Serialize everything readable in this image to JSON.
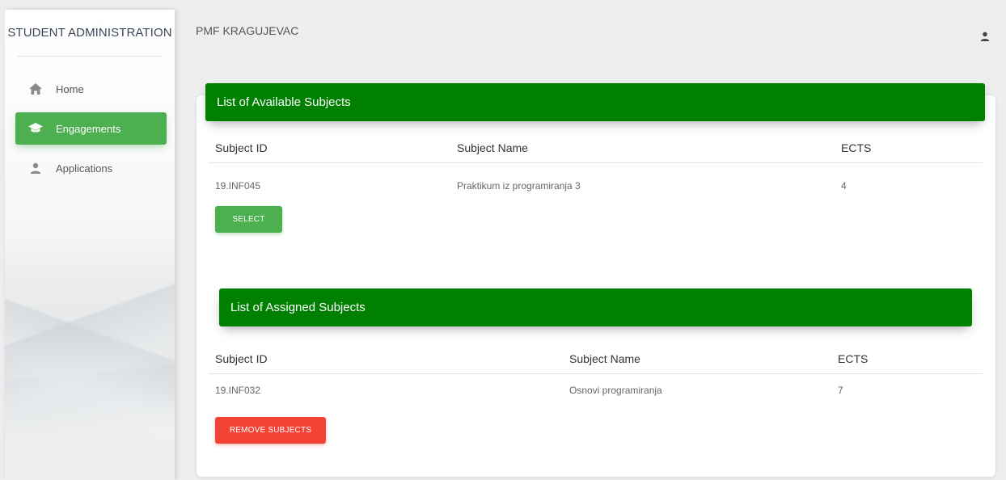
{
  "sidebar": {
    "brand": "STUDENT ADMINISTRATION",
    "items": [
      {
        "label": "Home",
        "icon": "home-icon"
      },
      {
        "label": "Engagements",
        "icon": "graduation-cap-icon",
        "active": true
      },
      {
        "label": "Applications",
        "icon": "person-icon"
      }
    ]
  },
  "header": {
    "title": "PMF KRAGUJEVAC",
    "user_icon": "person-icon"
  },
  "available": {
    "title": "List of Available Subjects",
    "columns": [
      "Subject ID",
      "Subject Name",
      "ECTS"
    ],
    "rows": [
      {
        "id": "19.INF045",
        "name": "Praktikum iz programiranja 3",
        "ects": "4"
      }
    ],
    "button": "SELECT"
  },
  "assigned": {
    "title": "List of Assigned Subjects",
    "columns": [
      "Subject ID",
      "Subject Name",
      "ECTS"
    ],
    "rows": [
      {
        "id": "19.INF032",
        "name": "Osnovi programiranja",
        "ects": "7"
      }
    ],
    "button": "REMOVE SUBJECTS"
  },
  "colors": {
    "accent_green": "#4caf50",
    "header_green": "#008000",
    "danger_red": "#f44336"
  }
}
